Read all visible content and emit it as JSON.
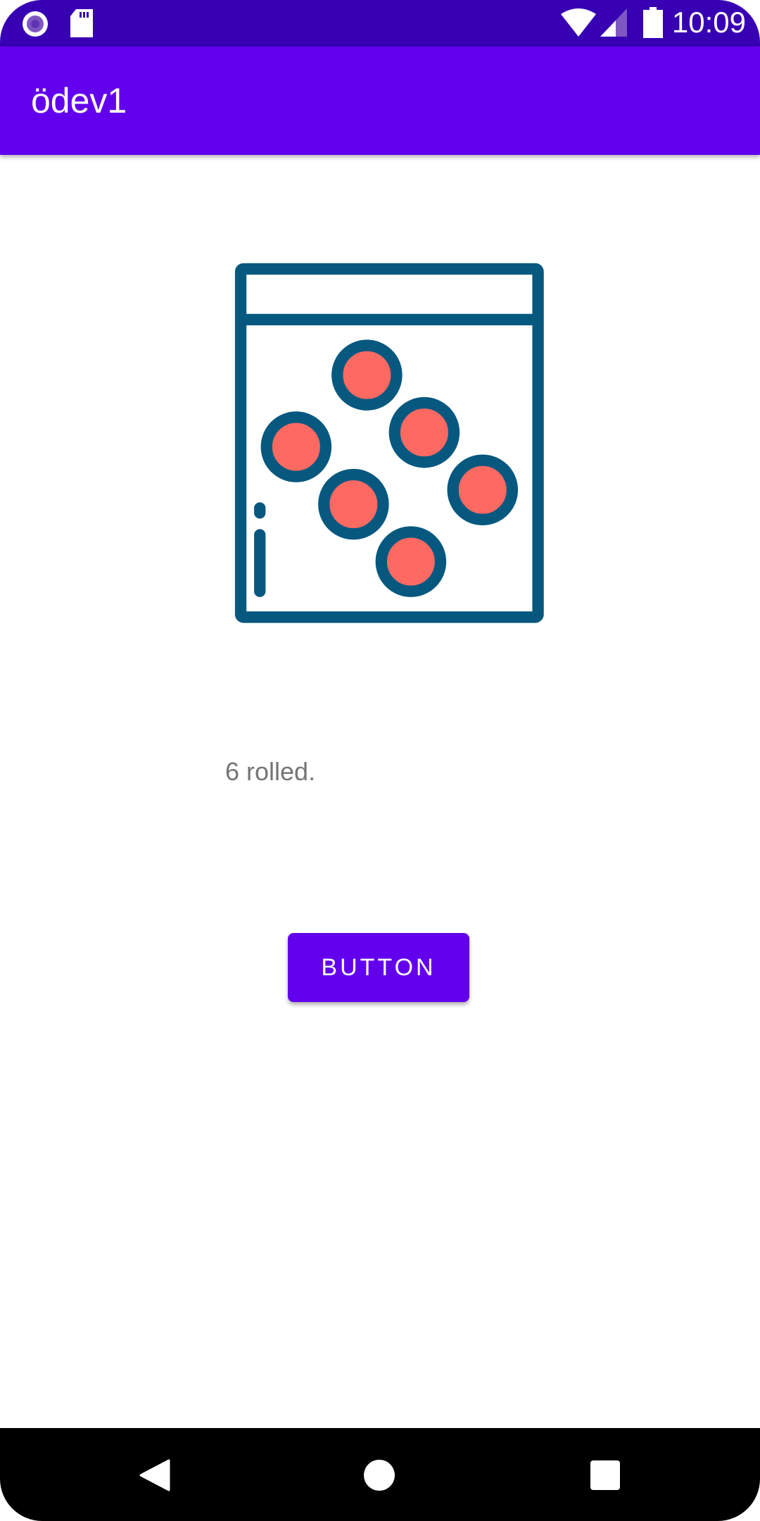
{
  "status_bar": {
    "time": "10:09",
    "icons": [
      "notification-icon",
      "sd-card-icon",
      "wifi-icon",
      "signal-icon",
      "battery-icon"
    ]
  },
  "app_bar": {
    "title": "ödev1"
  },
  "main": {
    "image": {
      "icon": "dice-bag-icon",
      "colors": {
        "outline": "#06587f",
        "dots": "#fe6961"
      }
    },
    "result_text": "6 rolled.",
    "button_label": "BUTTON"
  },
  "nav_bar": {
    "icons": [
      "back-icon",
      "home-icon",
      "recents-icon"
    ]
  },
  "colors": {
    "primary": "#6200ee",
    "primary_dark": "#3700b3"
  }
}
